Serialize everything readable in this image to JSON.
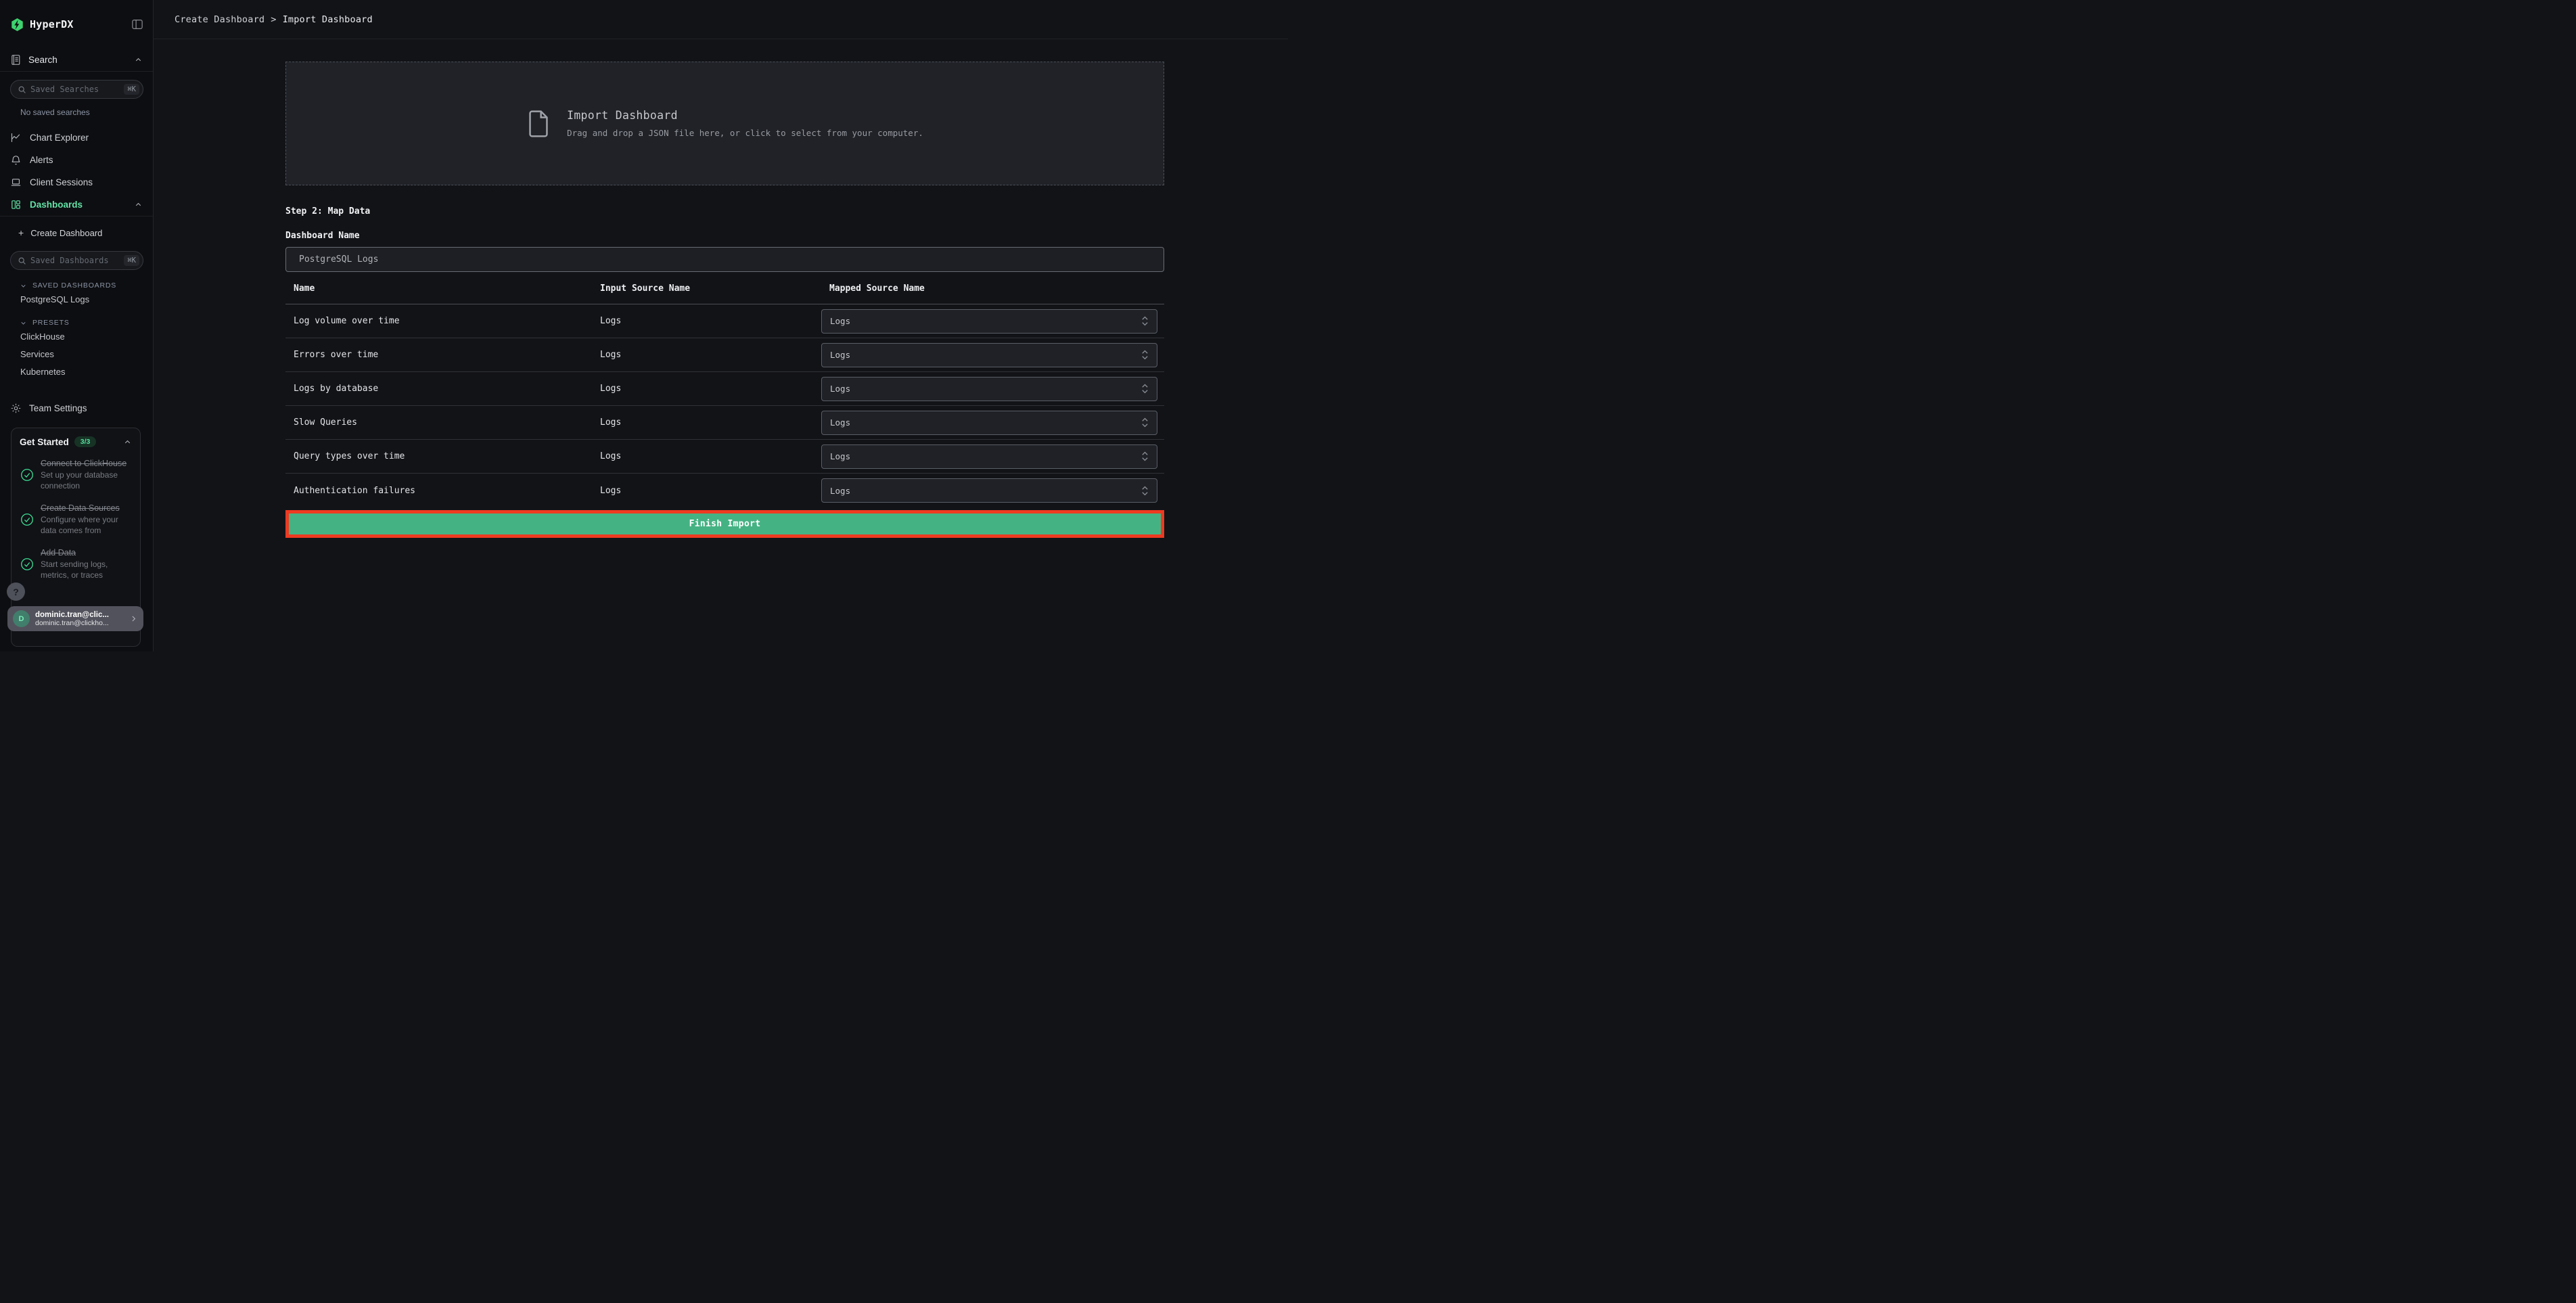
{
  "colors": {
    "accent_green": "#63e2a7",
    "button_green": "#45b283",
    "annotation_red": "#ee3a21",
    "logo_green": "#3ed26f"
  },
  "sidebar": {
    "brand": "HyperDX",
    "search": {
      "title": "Search",
      "placeholder": "Saved Searches",
      "shortcut": "⌘K",
      "empty": "No saved searches"
    },
    "nav": {
      "chart_explorer": "Chart Explorer",
      "alerts": "Alerts",
      "client_sessions": "Client Sessions",
      "dashboards": "Dashboards"
    },
    "create_dashboard": "Create Dashboard",
    "dashboards_search": {
      "placeholder": "Saved Dashboards",
      "shortcut": "⌘K"
    },
    "saved_dashboards": {
      "header": "SAVED DASHBOARDS",
      "items": [
        "PostgreSQL Logs"
      ]
    },
    "presets": {
      "header": "PRESETS",
      "items": [
        "ClickHouse",
        "Services",
        "Kubernetes"
      ]
    },
    "team_settings": "Team Settings",
    "get_started": {
      "title": "Get Started",
      "badge": "3/3",
      "items": [
        {
          "title": "Connect to ClickHouse",
          "desc": "Set up your database connection"
        },
        {
          "title": "Create Data Sources",
          "desc": "Configure where your data comes from"
        },
        {
          "title": "Add Data",
          "desc": "Start sending logs, metrics, or traces"
        }
      ]
    },
    "help_label": "?",
    "user": {
      "initial": "D",
      "display_name": "dominic.tran@clic...",
      "email": "dominic.tran@clickho..."
    }
  },
  "header": {
    "crumb1": "Create Dashboard",
    "separator": ">",
    "crumb2": "Import Dashboard"
  },
  "main": {
    "dropzone": {
      "title": "Import Dashboard",
      "subtitle": "Drag and drop a JSON file here, or click to select from your computer."
    },
    "step_label": "Step 2: Map Data",
    "dashboard_name_label": "Dashboard Name",
    "dashboard_name_value": "PostgreSQL Logs",
    "table": {
      "columns": [
        "Name",
        "Input Source Name",
        "Mapped Source Name"
      ],
      "rows": [
        {
          "name": "Log volume over time",
          "input_source": "Logs",
          "mapped_source": "Logs"
        },
        {
          "name": "Errors over time",
          "input_source": "Logs",
          "mapped_source": "Logs"
        },
        {
          "name": "Logs by database",
          "input_source": "Logs",
          "mapped_source": "Logs"
        },
        {
          "name": "Slow Queries",
          "input_source": "Logs",
          "mapped_source": "Logs"
        },
        {
          "name": "Query types over time",
          "input_source": "Logs",
          "mapped_source": "Logs"
        },
        {
          "name": "Authentication failures",
          "input_source": "Logs",
          "mapped_source": "Logs"
        }
      ]
    },
    "finish_button": "Finish Import"
  }
}
